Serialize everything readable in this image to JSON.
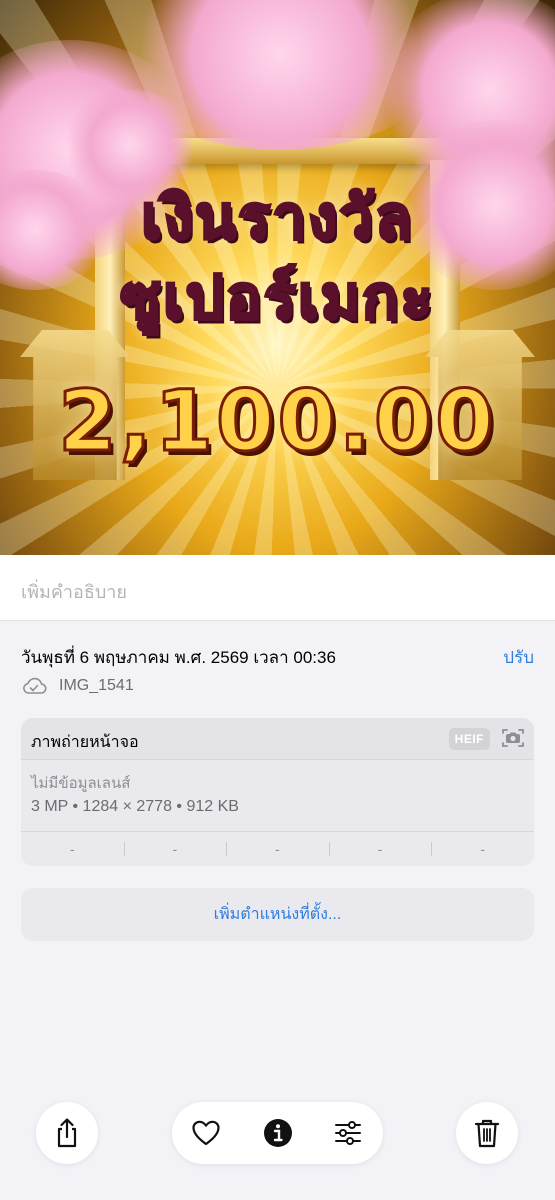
{
  "photo": {
    "win_title_line1": "เงินรางวัล",
    "win_title_line2": "ซูเปอร์เมกะ",
    "win_amount": "2,100.00"
  },
  "caption": {
    "placeholder": "เพิ่มคำอธิบาย"
  },
  "info": {
    "date_text": "วันพุธที่ 6 พฤษภาคม พ.ศ. 2569 เวลา 00:36",
    "adjust_label": "ปรับ",
    "file_name": "IMG_1541",
    "cloud_icon": "icloud-check-icon"
  },
  "metadata": {
    "title": "ภาพถ่ายหน้าจอ",
    "format_badge": "HEIF",
    "camera_icon": "screenshot-camera-icon",
    "lens_text": "ไม่มีข้อมูลเลนส์",
    "specs_text": "3 MP • 1284 × 2778 • 912 KB",
    "exif_cells": [
      "-",
      "-",
      "-",
      "-",
      "-"
    ]
  },
  "location": {
    "label": "เพิ่มตำแหน่งที่ตั้ง..."
  },
  "toolbar": {
    "share_icon": "share-icon",
    "favorite_icon": "heart-icon",
    "info_icon": "info-icon",
    "adjust_icon": "sliders-icon",
    "delete_icon": "trash-icon"
  },
  "colors": {
    "accent": "#2f7de1",
    "background": "#f2f2f7",
    "card": "#e9e9ee"
  }
}
